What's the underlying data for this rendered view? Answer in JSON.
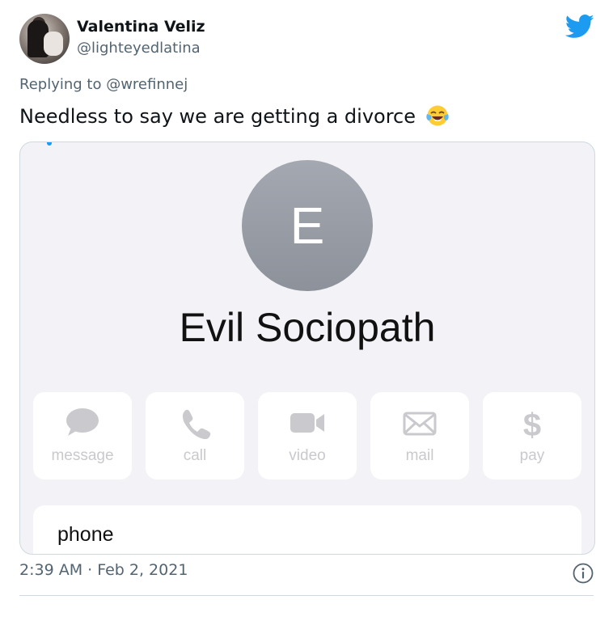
{
  "author": {
    "name": "Valentina Veliz",
    "handle": "@lighteyedlatina",
    "avatar_icon": "profile-photo"
  },
  "reply_context": {
    "prefix": "Replying to ",
    "mention": "@wrefinnej"
  },
  "tweet": {
    "text": "Needless to say we are getting a divorce",
    "emoji": "face-with-tears-of-joy"
  },
  "media": {
    "contact_initial": "E",
    "contact_name": "Evil Sociopath",
    "actions": [
      {
        "label": "message",
        "icon": "message-bubble-icon"
      },
      {
        "label": "call",
        "icon": "phone-icon"
      },
      {
        "label": "video",
        "icon": "video-camera-icon"
      },
      {
        "label": "mail",
        "icon": "envelope-icon"
      },
      {
        "label": "pay",
        "icon": "dollar-icon"
      }
    ],
    "phone_label": "phone"
  },
  "footer": {
    "timestamp": "2:39 AM · Feb 2, 2021",
    "info_icon": "info-icon"
  },
  "colors": {
    "twitter_blue": "#1d9bf0",
    "secondary_text": "#536471",
    "contact_bg": "#f2f2f7",
    "avatar_grey": "#9a9ea7",
    "disabled_action": "#c9c9ce"
  }
}
